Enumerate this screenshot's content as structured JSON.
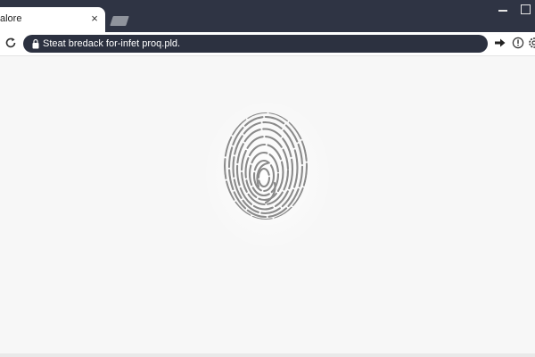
{
  "tab": {
    "title": "alore",
    "close_glyph": "×"
  },
  "address_bar": {
    "url": "Steat bredack for-infet proq.pld."
  },
  "icons": {
    "reload": "reload-icon",
    "lock": "lock-icon",
    "forward": "forward-icon",
    "info": "info-icon",
    "settings": "settings-icon",
    "fingerprint": "fingerprint-icon",
    "new_tab": "new-tab-icon",
    "minimize": "minimize-icon",
    "maximize": "maximize-icon"
  },
  "colors": {
    "tabstrip": "#2f3444",
    "omnibox": "#2c3140",
    "fingerprint": "#8a8a8a",
    "page_background": "#f7f7f7"
  }
}
